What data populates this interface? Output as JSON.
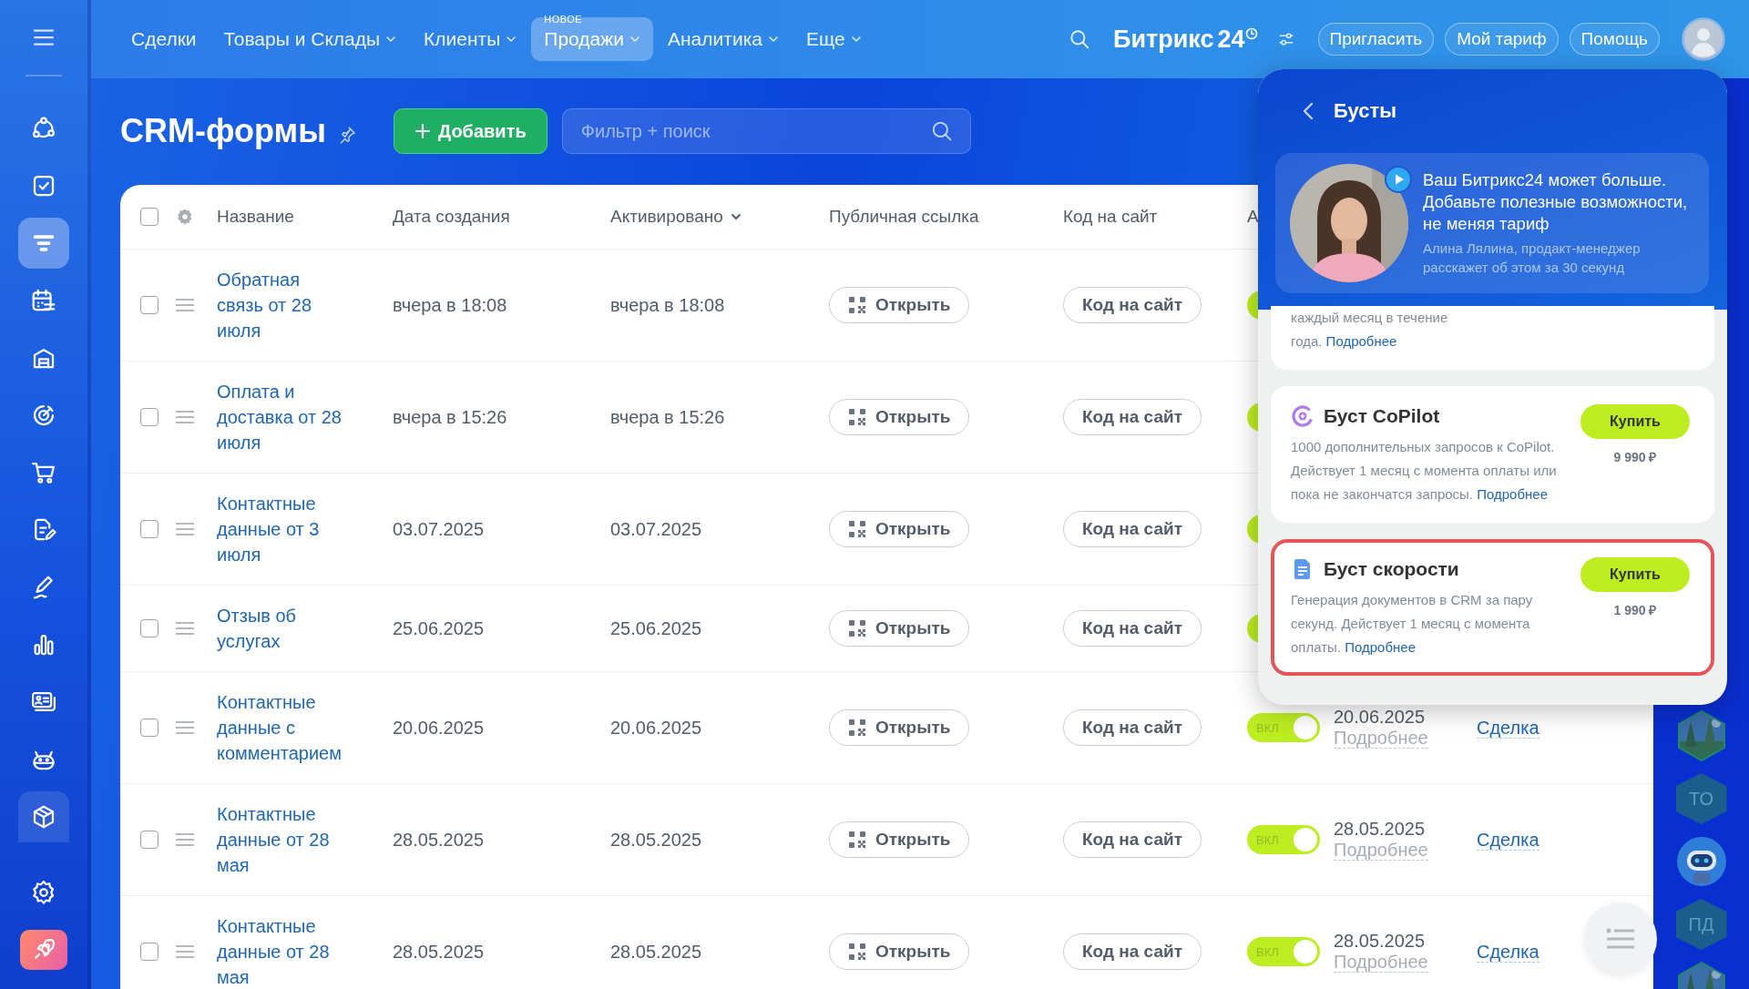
{
  "nav": [
    {
      "label": "Сделки",
      "has_menu": false,
      "selected": false
    },
    {
      "label": "Товары и Склады",
      "has_menu": true,
      "selected": false
    },
    {
      "label": "Клиенты",
      "has_menu": true,
      "selected": false
    },
    {
      "label": "Продажи",
      "has_menu": true,
      "selected": true,
      "badge": "НОВОЕ"
    },
    {
      "label": "Аналитика",
      "has_menu": true,
      "selected": false
    },
    {
      "label": "Еще",
      "has_menu": true,
      "selected": false
    }
  ],
  "brand": {
    "name": "Битрикс",
    "number": "24"
  },
  "header_buttons": [
    "Пригласить",
    "Мой тариф",
    "Помощь"
  ],
  "sidebar": {
    "items": [
      {
        "kind": "nodes",
        "selected": false,
        "highlighted": false
      },
      {
        "kind": "task",
        "selected": false,
        "highlighted": false
      },
      {
        "kind": "filter",
        "selected": true,
        "highlighted": false
      },
      {
        "kind": "calendar",
        "selected": false,
        "highlighted": false
      },
      {
        "kind": "garage",
        "selected": false,
        "highlighted": false
      },
      {
        "kind": "target",
        "selected": false,
        "highlighted": false
      },
      {
        "kind": "cart",
        "selected": false,
        "highlighted": false
      },
      {
        "kind": "document",
        "selected": false,
        "highlighted": false
      },
      {
        "kind": "pen",
        "selected": false,
        "highlighted": false
      },
      {
        "kind": "chart",
        "selected": false,
        "highlighted": false
      },
      {
        "kind": "card",
        "selected": false,
        "highlighted": false
      },
      {
        "kind": "robot",
        "selected": false,
        "highlighted": false
      },
      {
        "kind": "box",
        "selected": false,
        "highlighted": true
      },
      {
        "kind": "settings",
        "selected": false,
        "highlighted": false
      },
      {
        "kind": "rocket",
        "selected": false,
        "highlighted": false
      }
    ]
  },
  "page": {
    "title": "CRM-формы",
    "add_button": "Добавить",
    "search": {
      "placeholder": "Фильтр + поиск"
    }
  },
  "table": {
    "select_all": {
      "checked": false
    },
    "columns": [
      {
        "label": "Название",
        "sortable": false
      },
      {
        "label": "Дата создания",
        "sortable": false
      },
      {
        "label": "Активировано",
        "sortable": true
      },
      {
        "label": "Публичная ссылка",
        "sortable": false
      },
      {
        "label": "Код на сайт",
        "sortable": false
      },
      {
        "label": "А"
      }
    ],
    "rows": [
      {
        "name": "Обратная связь от 28 июля",
        "created": "вчера в 18:08",
        "activated": "вчера в 18:08",
        "link_button": "Открыть",
        "code_button": "Код на сайт",
        "checked": false,
        "active": true
      },
      {
        "name": "Оплата и доставка от 28 июля",
        "created": "вчера в 15:26",
        "activated": "вчера в 15:26",
        "link_button": "Открыть",
        "code_button": "Код на сайт",
        "checked": false,
        "active": true
      },
      {
        "name": "Контактные данные от 3 июля",
        "created": "03.07.2025",
        "activated": "03.07.2025",
        "link_button": "Открыть",
        "code_button": "Код на сайт",
        "checked": false,
        "active": true
      },
      {
        "name": "Отзыв об услугах",
        "created": "25.06.2025",
        "activated": "25.06.2025",
        "link_button": "Открыть",
        "code_button": "Код на сайт",
        "checked": false,
        "active": true
      },
      {
        "name": "Контактные данные с комментарием",
        "created": "20.06.2025",
        "activated": "20.06.2025",
        "link_button": "Открыть",
        "code_button": "Код на сайт",
        "checked": false,
        "active": true,
        "toggle_label": "ВКЛ",
        "date": "20.06.2025",
        "details": "Подробнее",
        "entity": "Сделка"
      },
      {
        "name": "Контактные данные от 28 мая",
        "created": "28.05.2025",
        "activated": "28.05.2025",
        "link_button": "Открыть",
        "code_button": "Код на сайт",
        "checked": false,
        "active": true,
        "toggle_label": "ВКЛ",
        "date": "28.05.2025",
        "details": "Подробнее",
        "entity": "Сделка"
      },
      {
        "name": "Контактные данные от 28 мая",
        "created": "28.05.2025",
        "activated": "28.05.2025",
        "link_button": "Открыть",
        "code_button": "Код на сайт",
        "checked": false,
        "active": true,
        "toggle_label": "ВКЛ",
        "date": "28.05.2025",
        "details": "Подробнее",
        "entity": "Сделка"
      }
    ]
  },
  "boosts": {
    "title": "Бусты",
    "promo": {
      "headline": "Ваш Битрикс24 может больше. Добавьте полезные возможности, не меняя тариф",
      "author": "Алина Лялина, продакт-менеджер",
      "caption": "расскажет об этом за 30 секунд"
    },
    "cards": [
      {
        "kind": "partial",
        "text": "каждый месяц в течение года.",
        "link": "Подробнее",
        "highlighted": false
      },
      {
        "kind": "copilot",
        "title": "Буст CoPilot",
        "text": "1000 дополнительных запросов к CoPilot. Действует 1 месяц с момента оплаты или пока не закончатся запросы.",
        "link": "Подробнее",
        "buy_button": "Купить",
        "price": "9 990 ₽",
        "highlighted": false
      },
      {
        "kind": "document",
        "title": "Буст скорости",
        "text": "Генерация документов в CRM за пару секунд. Действует 1 месяц с момента оплаты.",
        "link": "Подробнее",
        "buy_button": "Купить",
        "price": "1 990 ₽",
        "highlighted": true
      }
    ]
  },
  "right_rail": {
    "items": [
      {
        "kind": "picture"
      },
      {
        "kind": "initials",
        "text": "ТО"
      },
      {
        "kind": "robot"
      },
      {
        "kind": "initials",
        "text": "ПД"
      },
      {
        "kind": "picture"
      }
    ]
  }
}
